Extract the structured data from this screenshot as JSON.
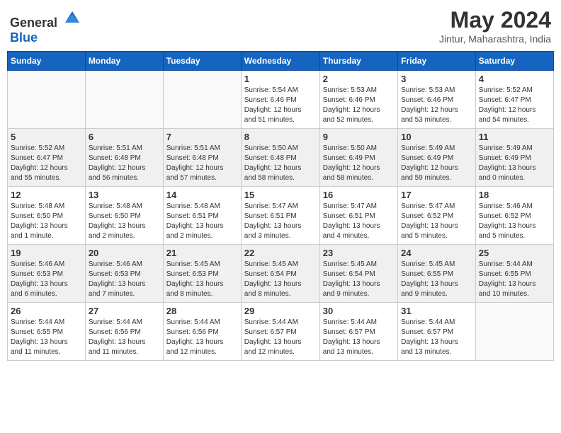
{
  "header": {
    "logo_general": "General",
    "logo_blue": "Blue",
    "month": "May 2024",
    "location": "Jintur, Maharashtra, India"
  },
  "days_of_week": [
    "Sunday",
    "Monday",
    "Tuesday",
    "Wednesday",
    "Thursday",
    "Friday",
    "Saturday"
  ],
  "weeks": [
    [
      {
        "day": "",
        "info": ""
      },
      {
        "day": "",
        "info": ""
      },
      {
        "day": "",
        "info": ""
      },
      {
        "day": "1",
        "info": "Sunrise: 5:54 AM\nSunset: 6:46 PM\nDaylight: 12 hours\nand 51 minutes."
      },
      {
        "day": "2",
        "info": "Sunrise: 5:53 AM\nSunset: 6:46 PM\nDaylight: 12 hours\nand 52 minutes."
      },
      {
        "day": "3",
        "info": "Sunrise: 5:53 AM\nSunset: 6:46 PM\nDaylight: 12 hours\nand 53 minutes."
      },
      {
        "day": "4",
        "info": "Sunrise: 5:52 AM\nSunset: 6:47 PM\nDaylight: 12 hours\nand 54 minutes."
      }
    ],
    [
      {
        "day": "5",
        "info": "Sunrise: 5:52 AM\nSunset: 6:47 PM\nDaylight: 12 hours\nand 55 minutes."
      },
      {
        "day": "6",
        "info": "Sunrise: 5:51 AM\nSunset: 6:48 PM\nDaylight: 12 hours\nand 56 minutes."
      },
      {
        "day": "7",
        "info": "Sunrise: 5:51 AM\nSunset: 6:48 PM\nDaylight: 12 hours\nand 57 minutes."
      },
      {
        "day": "8",
        "info": "Sunrise: 5:50 AM\nSunset: 6:48 PM\nDaylight: 12 hours\nand 58 minutes."
      },
      {
        "day": "9",
        "info": "Sunrise: 5:50 AM\nSunset: 6:49 PM\nDaylight: 12 hours\nand 58 minutes."
      },
      {
        "day": "10",
        "info": "Sunrise: 5:49 AM\nSunset: 6:49 PM\nDaylight: 12 hours\nand 59 minutes."
      },
      {
        "day": "11",
        "info": "Sunrise: 5:49 AM\nSunset: 6:49 PM\nDaylight: 13 hours\nand 0 minutes."
      }
    ],
    [
      {
        "day": "12",
        "info": "Sunrise: 5:48 AM\nSunset: 6:50 PM\nDaylight: 13 hours\nand 1 minute."
      },
      {
        "day": "13",
        "info": "Sunrise: 5:48 AM\nSunset: 6:50 PM\nDaylight: 13 hours\nand 2 minutes."
      },
      {
        "day": "14",
        "info": "Sunrise: 5:48 AM\nSunset: 6:51 PM\nDaylight: 13 hours\nand 2 minutes."
      },
      {
        "day": "15",
        "info": "Sunrise: 5:47 AM\nSunset: 6:51 PM\nDaylight: 13 hours\nand 3 minutes."
      },
      {
        "day": "16",
        "info": "Sunrise: 5:47 AM\nSunset: 6:51 PM\nDaylight: 13 hours\nand 4 minutes."
      },
      {
        "day": "17",
        "info": "Sunrise: 5:47 AM\nSunset: 6:52 PM\nDaylight: 13 hours\nand 5 minutes."
      },
      {
        "day": "18",
        "info": "Sunrise: 5:46 AM\nSunset: 6:52 PM\nDaylight: 13 hours\nand 5 minutes."
      }
    ],
    [
      {
        "day": "19",
        "info": "Sunrise: 5:46 AM\nSunset: 6:53 PM\nDaylight: 13 hours\nand 6 minutes."
      },
      {
        "day": "20",
        "info": "Sunrise: 5:46 AM\nSunset: 6:53 PM\nDaylight: 13 hours\nand 7 minutes."
      },
      {
        "day": "21",
        "info": "Sunrise: 5:45 AM\nSunset: 6:53 PM\nDaylight: 13 hours\nand 8 minutes."
      },
      {
        "day": "22",
        "info": "Sunrise: 5:45 AM\nSunset: 6:54 PM\nDaylight: 13 hours\nand 8 minutes."
      },
      {
        "day": "23",
        "info": "Sunrise: 5:45 AM\nSunset: 6:54 PM\nDaylight: 13 hours\nand 9 minutes."
      },
      {
        "day": "24",
        "info": "Sunrise: 5:45 AM\nSunset: 6:55 PM\nDaylight: 13 hours\nand 9 minutes."
      },
      {
        "day": "25",
        "info": "Sunrise: 5:44 AM\nSunset: 6:55 PM\nDaylight: 13 hours\nand 10 minutes."
      }
    ],
    [
      {
        "day": "26",
        "info": "Sunrise: 5:44 AM\nSunset: 6:55 PM\nDaylight: 13 hours\nand 11 minutes."
      },
      {
        "day": "27",
        "info": "Sunrise: 5:44 AM\nSunset: 6:56 PM\nDaylight: 13 hours\nand 11 minutes."
      },
      {
        "day": "28",
        "info": "Sunrise: 5:44 AM\nSunset: 6:56 PM\nDaylight: 13 hours\nand 12 minutes."
      },
      {
        "day": "29",
        "info": "Sunrise: 5:44 AM\nSunset: 6:57 PM\nDaylight: 13 hours\nand 12 minutes."
      },
      {
        "day": "30",
        "info": "Sunrise: 5:44 AM\nSunset: 6:57 PM\nDaylight: 13 hours\nand 13 minutes."
      },
      {
        "day": "31",
        "info": "Sunrise: 5:44 AM\nSunset: 6:57 PM\nDaylight: 13 hours\nand 13 minutes."
      },
      {
        "day": "",
        "info": ""
      }
    ]
  ]
}
